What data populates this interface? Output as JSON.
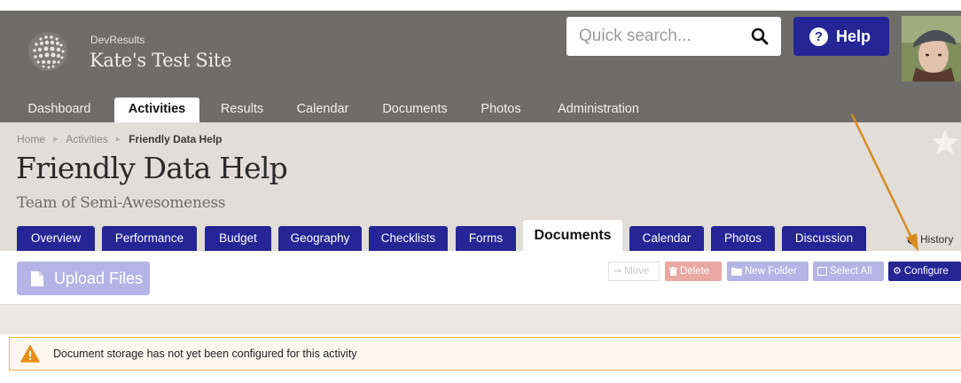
{
  "header": {
    "org_name": "DevResults",
    "site_name": "Kate's Test Site",
    "search_placeholder": "Quick search...",
    "help_label": "Help"
  },
  "mainnav": {
    "items": [
      {
        "label": "Dashboard"
      },
      {
        "label": "Activities",
        "active": true
      },
      {
        "label": "Results"
      },
      {
        "label": "Calendar"
      },
      {
        "label": "Documents"
      },
      {
        "label": "Photos"
      },
      {
        "label": "Administration"
      }
    ]
  },
  "breadcrumb": {
    "items": [
      "Home",
      "Activities",
      "Friendly Data Help"
    ]
  },
  "activity": {
    "title": "Friendly Data Help",
    "subtitle": "Team of Semi-Awesomeness"
  },
  "tabs": [
    {
      "label": "Overview"
    },
    {
      "label": "Performance"
    },
    {
      "label": "Budget"
    },
    {
      "label": "Geography"
    },
    {
      "label": "Checklists"
    },
    {
      "label": "Forms"
    },
    {
      "label": "Documents",
      "active": true
    },
    {
      "label": "Calendar"
    },
    {
      "label": "Photos"
    },
    {
      "label": "Discussion"
    }
  ],
  "history_label": "History",
  "toolbar": {
    "upload_label": "Upload Files",
    "move_label": "Move",
    "delete_label": "Delete",
    "new_folder_label": "New Folder",
    "select_all_label": "Select All",
    "configure_label": "Configure"
  },
  "alert": {
    "message": "Document storage has not yet been configured for this activity"
  },
  "colors": {
    "header_bg": "#6f6d6a",
    "activity_bg": "#e1ddd8",
    "primary": "#252595",
    "primary_disabled": "#b5b4e6",
    "danger_disabled": "#e9a8a3",
    "annotation_arrow": "#d98a1f",
    "alert_border": "#f0b55a"
  }
}
